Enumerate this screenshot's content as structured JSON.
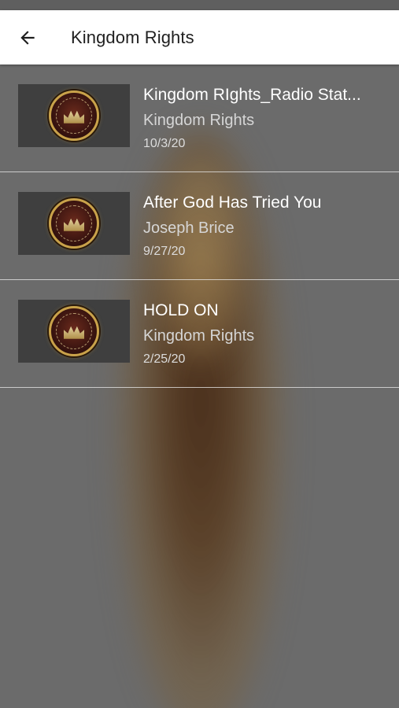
{
  "app_bar": {
    "back_icon": "arrow-back-icon",
    "title": "Kingdom Rights"
  },
  "items": [
    {
      "title": "Kingdom RIghts_Radio Stat...",
      "author": "Kingdom Rights",
      "date": "10/3/20",
      "thumbnail_icon": "kingdom-ministries-logo"
    },
    {
      "title": "After God Has Tried You",
      "author": "Joseph Brice",
      "date": "9/27/20",
      "thumbnail_icon": "kingdom-ministries-logo"
    },
    {
      "title": "HOLD ON",
      "author": "Kingdom Rights",
      "date": "2/25/20",
      "thumbnail_icon": "kingdom-ministries-logo"
    }
  ],
  "colors": {
    "app_bar_background": "#ffffff",
    "list_background": "#6b6b6b",
    "thumbnail_background": "#3f3f3f",
    "primary_text": "#ffffff",
    "secondary_text": "#d6d6d6"
  }
}
